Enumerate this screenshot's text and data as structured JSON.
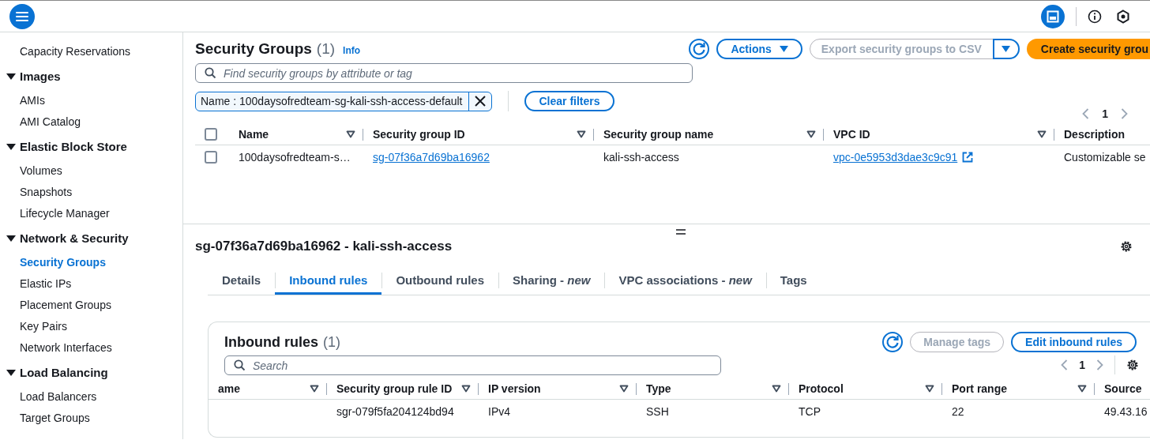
{
  "sidebar": {
    "sections": [
      {
        "items": [
          {
            "label": "Capacity Reservations",
            "selected": false
          }
        ]
      },
      {
        "heading": "Images",
        "expanded": true,
        "items": [
          {
            "label": "AMIs",
            "selected": false
          },
          {
            "label": "AMI Catalog",
            "selected": false
          }
        ]
      },
      {
        "heading": "Elastic Block Store",
        "expanded": true,
        "items": [
          {
            "label": "Volumes",
            "selected": false
          },
          {
            "label": "Snapshots",
            "selected": false
          },
          {
            "label": "Lifecycle Manager",
            "selected": false
          }
        ]
      },
      {
        "heading": "Network & Security",
        "expanded": true,
        "items": [
          {
            "label": "Security Groups",
            "selected": true
          },
          {
            "label": "Elastic IPs",
            "selected": false
          },
          {
            "label": "Placement Groups",
            "selected": false
          },
          {
            "label": "Key Pairs",
            "selected": false
          },
          {
            "label": "Network Interfaces",
            "selected": false
          }
        ]
      },
      {
        "heading": "Load Balancing",
        "expanded": true,
        "items": [
          {
            "label": "Load Balancers",
            "selected": false
          },
          {
            "label": "Target Groups",
            "selected": false
          }
        ]
      }
    ]
  },
  "list": {
    "title": "Security Groups",
    "count": "(1)",
    "info": "Info",
    "actions": [
      {
        "kind": "refresh",
        "disabled": false
      },
      {
        "kind": "dropdown",
        "label": "Actions",
        "disabled": false
      },
      {
        "kind": "split",
        "label": "Export security groups to CSV",
        "disabled": true
      },
      {
        "kind": "primary",
        "label": "Create security grou",
        "disabled": false
      }
    ],
    "search": {
      "placeholder": "Find security groups by attribute or tag"
    },
    "filter": {
      "token": "Name : 100daysofredteam-sg-kali-ssh-access-default"
    },
    "clear_button": "Clear filters",
    "page": "1",
    "table": {
      "header_checked": false,
      "columns": [
        {
          "label": "Name",
          "sortable": true
        },
        {
          "label": "Security group ID",
          "sortable": true
        },
        {
          "label": "Security group name",
          "sortable": true
        },
        {
          "label": "VPC ID",
          "sortable": true
        },
        {
          "label": "Description",
          "sortable": false
        }
      ],
      "rows": [
        {
          "checked": false,
          "cells": [
            {
              "kind": "text",
              "text": "100daysofredteam-s…"
            },
            {
              "kind": "link",
              "text": "sg-07f36a7d69ba16962"
            },
            {
              "kind": "text",
              "text": "kali-ssh-access"
            },
            {
              "kind": "external_link",
              "text": "vpc-0e5953d3dae3c9c91"
            },
            {
              "kind": "text",
              "text": "Customizable se"
            }
          ]
        }
      ]
    }
  },
  "detail": {
    "title": "sg-07f36a7d69ba16962 - kali-ssh-access",
    "tabs": [
      {
        "label": "Details",
        "selected": false
      },
      {
        "label": "Inbound rules",
        "selected": true
      },
      {
        "label": "Outbound rules",
        "selected": false
      },
      {
        "label": "Sharing - *new*",
        "selected": false
      },
      {
        "label": "VPC associations - *new*",
        "selected": false
      },
      {
        "label": "Tags",
        "selected": false
      }
    ],
    "panel": {
      "title": "Inbound rules",
      "count": "(1)",
      "actions": [
        {
          "kind": "refresh",
          "disabled": false
        },
        {
          "kind": "normal",
          "label": "Manage tags",
          "disabled": true
        },
        {
          "kind": "normal",
          "label": "Edit inbound rules",
          "disabled": false
        }
      ],
      "search": {
        "placeholder": "Search"
      },
      "page": "1",
      "table": {
        "columns": [
          {
            "label": "ame",
            "sortable": true
          },
          {
            "label": "Security group rule ID",
            "sortable": true
          },
          {
            "label": "IP version",
            "sortable": true
          },
          {
            "label": "Type",
            "sortable": true
          },
          {
            "label": "Protocol",
            "sortable": true
          },
          {
            "label": "Port range",
            "sortable": true
          },
          {
            "label": "Source",
            "sortable": false
          }
        ],
        "rows": [
          {
            "cells": [
              {
                "text": ""
              },
              {
                "kind": "text",
                "text": "sgr-079f5fa204124bd94"
              },
              {
                "kind": "text",
                "text": "IPv4"
              },
              {
                "kind": "text",
                "text": "SSH"
              },
              {
                "kind": "text",
                "text": "TCP"
              },
              {
                "kind": "text",
                "text": "22"
              },
              {
                "kind": "text",
                "text": "49.43.16"
              }
            ]
          }
        ]
      }
    }
  }
}
